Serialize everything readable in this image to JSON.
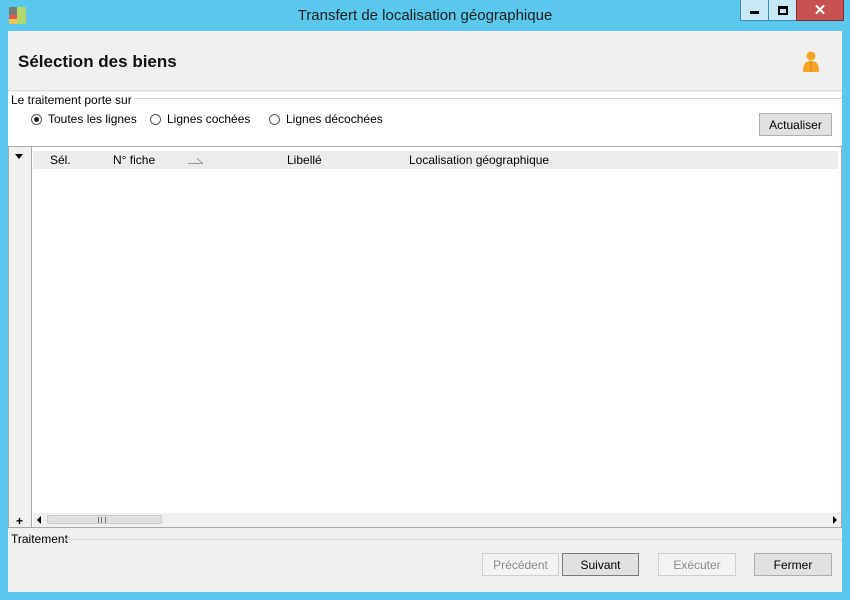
{
  "window": {
    "title": "Transfert de localisation géographique",
    "icon": "app-tiles-icon",
    "controls": [
      "minimize-icon",
      "maximize-icon",
      "close-icon"
    ]
  },
  "header": {
    "title": "Sélection des biens",
    "user_icon": "user-icon"
  },
  "filter": {
    "group_label": "Le traitement porte sur",
    "options": [
      {
        "label": "Toutes les lignes",
        "checked": true
      },
      {
        "label": "Lignes cochées",
        "checked": false
      },
      {
        "label": "Lignes décochées",
        "checked": false
      }
    ],
    "refresh_label": "Actualiser"
  },
  "grid": {
    "columns": [
      "Sél.",
      "N° fiche",
      "Libellé",
      "Localisation géographique"
    ],
    "rows": [],
    "add_row_label": "+"
  },
  "footer": {
    "group_label": "Traitement",
    "buttons": {
      "previous": "Précédent",
      "next": "Suivant",
      "execute": "Exécuter",
      "close": "Fermer"
    }
  },
  "colors": {
    "title_bar": "#5ac8ec",
    "close_button": "#c75050",
    "panel_bg": "#f0f0f0",
    "user_icon": "#f4a623"
  }
}
